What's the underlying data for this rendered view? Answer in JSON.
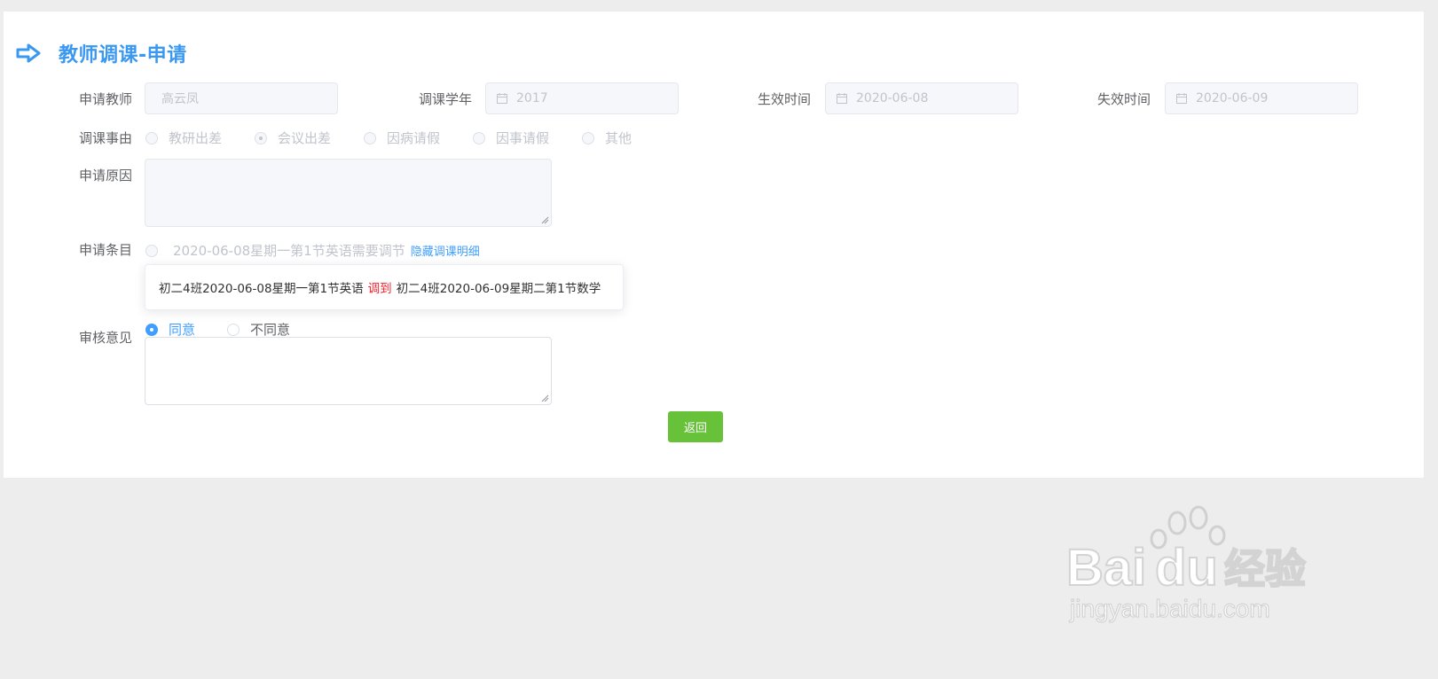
{
  "page": {
    "title": "教师调课-申请"
  },
  "form": {
    "teacher_label": "申请教师",
    "teacher_value": "高云凤",
    "year_label": "调课学年",
    "year_value": "2017",
    "effective_label": "生效时间",
    "effective_value": "2020-06-08",
    "expire_label": "失效时间",
    "expire_value": "2020-06-09",
    "reason_type_label": "调课事由",
    "reason_types": [
      "教研出差",
      "会议出差",
      "因病请假",
      "因事请假",
      "其他"
    ],
    "reason_type_selected": "会议出差",
    "reason_label": "申请原因",
    "reason_value": "",
    "item_label": "申请条目",
    "item_text": "2020-06-08星期一第1节英语需要调节",
    "hide_detail_link": "隐藏调课明细",
    "detail": {
      "from": "初二4班2020-06-08星期一第1节英语",
      "arrow": "调到",
      "to": "初二4班2020-06-09星期二第1节数学"
    },
    "review_label": "审核意见",
    "review_options": [
      "同意",
      "不同意"
    ],
    "review_selected": "同意",
    "review_comment": ""
  },
  "actions": {
    "back_label": "返回"
  },
  "watermark": {
    "brand": "Bai du 经验",
    "url": "jingyan.baidu.com"
  },
  "colors": {
    "accent": "#409eff",
    "title": "#3a98f0",
    "success": "#67c23a",
    "danger": "#f5222d"
  }
}
